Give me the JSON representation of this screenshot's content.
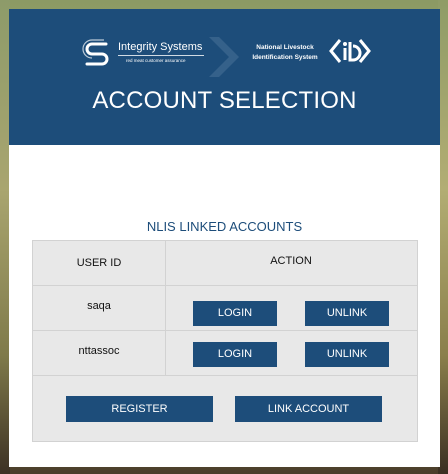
{
  "header": {
    "title": "ACCOUNT SELECTION",
    "integrity_logo": {
      "name": "Integrity Systems",
      "tagline": "red meat customer assurance"
    },
    "nlis_logo": {
      "line1": "National Livestock",
      "line2": "Identification System"
    }
  },
  "accounts": {
    "section_title": "NLIS LINKED ACCOUNTS",
    "columns": [
      "USER ID",
      "ACTION"
    ],
    "rows": [
      {
        "user_id": "saqa",
        "login_label": "LOGIN",
        "unlink_label": "UNLINK"
      },
      {
        "user_id": "nttassoc",
        "login_label": "LOGIN",
        "unlink_label": "UNLINK"
      }
    ]
  },
  "footer_actions": {
    "register_label": "REGISTER",
    "link_account_label": "LINK ACCOUNT"
  },
  "colors": {
    "brand_blue": "#1d4d7a",
    "panel_grey": "#e8e8e8"
  }
}
